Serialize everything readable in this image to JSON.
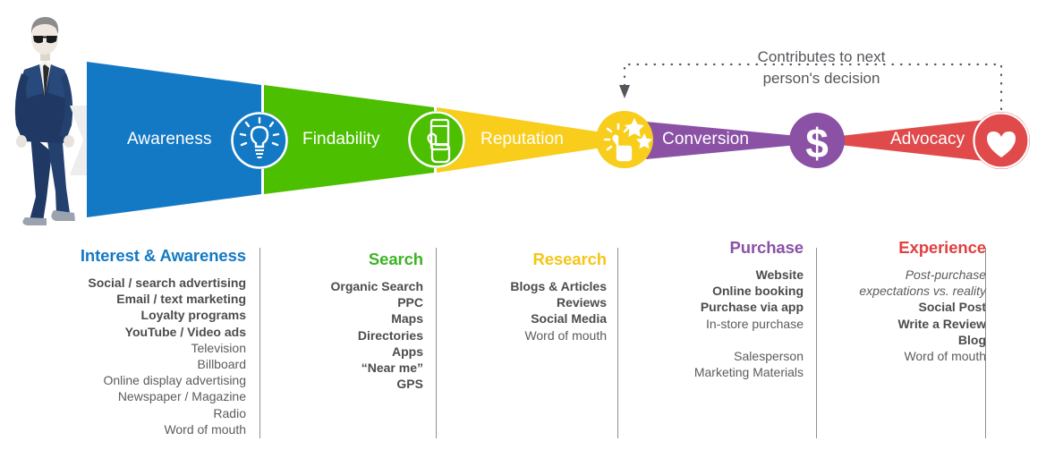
{
  "funnel": {
    "stages": [
      {
        "key": "awareness",
        "label": "Awareness",
        "color": "#1479C4",
        "icon": "lightbulb-icon"
      },
      {
        "key": "findability",
        "label": "Findability",
        "color": "#4CBF00",
        "icon": "hand-phone-icon"
      },
      {
        "key": "reputation",
        "label": "Reputation",
        "color": "#F8CD1C",
        "icon": "finger-stars-icon"
      },
      {
        "key": "conversion",
        "label": "Conversion",
        "color": "#8A51A5",
        "icon": "dollar-icon"
      },
      {
        "key": "advocacy",
        "label": "Advocacy",
        "color": "#E04A4A",
        "icon": "heart-icon"
      }
    ],
    "entry_figure": "businessman-illustration",
    "entry_arrow": "entry-chevron-icon"
  },
  "annotation": {
    "line1": "Contributes to next",
    "line2": "person's decision",
    "connector": "dotted-feedback-arrow"
  },
  "columns": [
    {
      "key": "interest-awareness",
      "heading": "Interest & Awareness",
      "heading_color": "#1479C4",
      "items": [
        {
          "text": "Social / search advertising",
          "style": "b"
        },
        {
          "text": "Email / text marketing",
          "style": "b"
        },
        {
          "text": "Loyalty programs",
          "style": "b"
        },
        {
          "text": "YouTube / Video ads",
          "style": "b"
        },
        {
          "text": "Television",
          "style": "n"
        },
        {
          "text": "Billboard",
          "style": "n"
        },
        {
          "text": "Online display advertising",
          "style": "n"
        },
        {
          "text": "Newspaper / Magazine",
          "style": "n"
        },
        {
          "text": "Radio",
          "style": "n"
        },
        {
          "text": "Word of mouth",
          "style": "n"
        }
      ]
    },
    {
      "key": "search",
      "heading": "Search",
      "heading_color": "#3DB324",
      "items": [
        {
          "text": "Organic Search",
          "style": "b"
        },
        {
          "text": "PPC",
          "style": "b"
        },
        {
          "text": "Maps",
          "style": "b"
        },
        {
          "text": "Directories",
          "style": "b"
        },
        {
          "text": "Apps",
          "style": "b"
        },
        {
          "text": "“Near me”",
          "style": "b"
        },
        {
          "text": "GPS",
          "style": "b"
        }
      ]
    },
    {
      "key": "research",
      "heading": "Research",
      "heading_color": "#F5C518",
      "items": [
        {
          "text": "Blogs & Articles",
          "style": "b"
        },
        {
          "text": "Reviews",
          "style": "b"
        },
        {
          "text": "Social Media",
          "style": "b"
        },
        {
          "text": "Word of mouth",
          "style": "n"
        }
      ]
    },
    {
      "key": "purchase",
      "heading": "Purchase",
      "heading_color": "#8A51A5",
      "items": [
        {
          "text": "Website",
          "style": "b"
        },
        {
          "text": "Online booking",
          "style": "b"
        },
        {
          "text": "Purchase via app",
          "style": "b"
        },
        {
          "text": "In-store purchase",
          "style": "n"
        },
        {
          "text": "",
          "style": "sp"
        },
        {
          "text": "Salesperson",
          "style": "n"
        },
        {
          "text": "Marketing Materials",
          "style": "n"
        }
      ]
    },
    {
      "key": "experience",
      "heading": "Experience",
      "heading_color": "#E0403F",
      "items": [
        {
          "text": "Post-purchase",
          "style": "i"
        },
        {
          "text": "expectations vs. reality",
          "style": "i"
        },
        {
          "text": "Social Post",
          "style": "b"
        },
        {
          "text": "Write a Review",
          "style": "b"
        },
        {
          "text": "Blog",
          "style": "b"
        },
        {
          "text": "Word of mouth",
          "style": "n"
        }
      ]
    }
  ]
}
